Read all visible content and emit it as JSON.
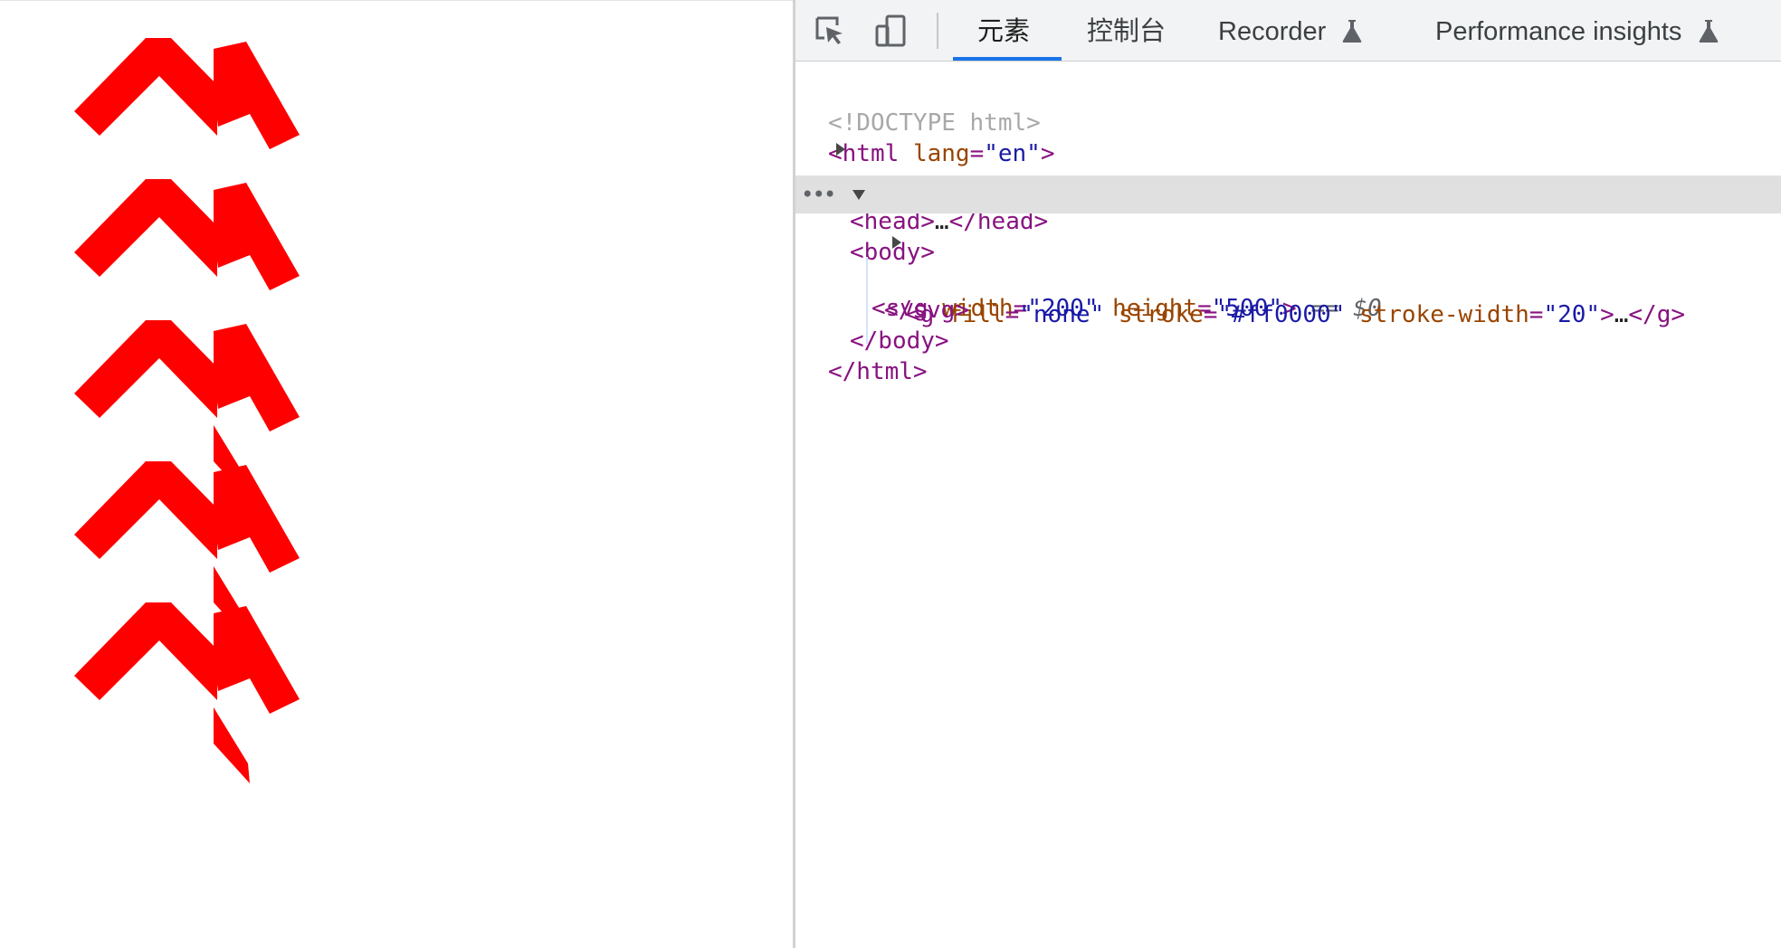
{
  "page": {
    "drawing": {
      "stroke_color": "#ff0000",
      "shape_count": 5
    }
  },
  "devtools": {
    "tabs": [
      {
        "label": "元素",
        "active": true
      },
      {
        "label": "控制台",
        "active": false
      },
      {
        "label": "Recorder",
        "experimental": true,
        "active": false
      },
      {
        "label": "Performance insights",
        "experimental": true,
        "active": false
      }
    ],
    "tree": {
      "doctype": "<!DOCTYPE html>",
      "html": {
        "tag": "html",
        "attr": "lang",
        "value": "\"en\""
      },
      "head": {
        "open": "<head>",
        "ellipsis": "…",
        "close": "</head>"
      },
      "body_open": "<body>",
      "svg": {
        "tag": "svg",
        "attrs": [
          {
            "name": "width",
            "value": "\"200\""
          },
          {
            "name": "height",
            "value": "\"500\""
          }
        ],
        "suffix": "== $0"
      },
      "g": {
        "tag": "g",
        "attrs": [
          {
            "name": "fill",
            "value": "\"none\""
          },
          {
            "name": "stroke",
            "value": "\"#ff0000\""
          },
          {
            "name": "stroke-width",
            "value": "\"20\""
          }
        ],
        "ellipsis": "…",
        "close": "</g>"
      },
      "svg_close": "</svg>",
      "body_close": "</body>",
      "html_close": "</html>",
      "selected_marker": "•••"
    }
  },
  "colors": {
    "tab_accent": "#1a73e8",
    "tag": "#881280",
    "attr_name": "#994500",
    "attr_value": "#1a1aa6",
    "selected_row": "#e0e0e0"
  }
}
